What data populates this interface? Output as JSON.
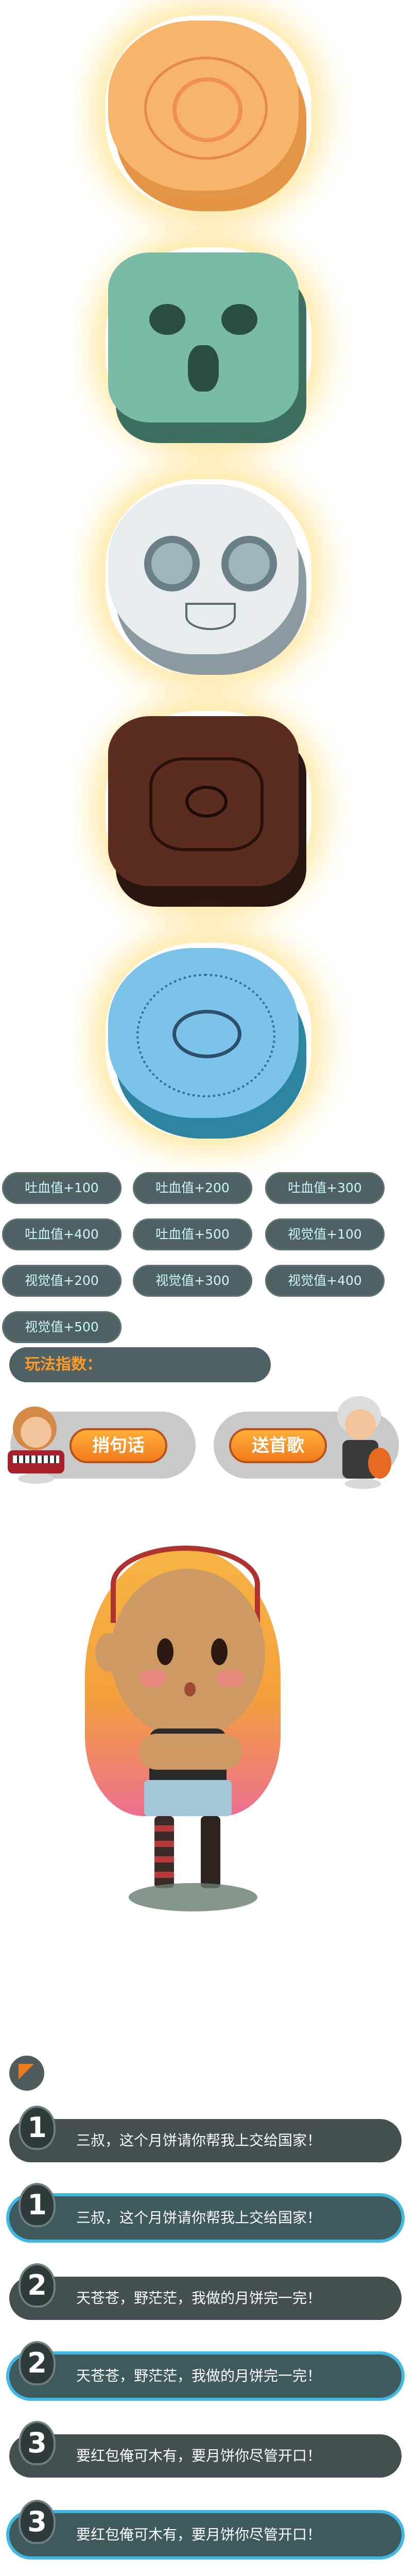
{
  "stats": [
    {
      "label": "吐血值+100"
    },
    {
      "label": "吐血值+200"
    },
    {
      "label": "吐血值+300"
    },
    {
      "label": "吐血值+400"
    },
    {
      "label": "吐血值+500"
    },
    {
      "label": "视觉值+100"
    },
    {
      "label": "视觉值+200"
    },
    {
      "label": "视觉值+300"
    },
    {
      "label": "视觉值+400"
    },
    {
      "label": "视觉值+500"
    }
  ],
  "strategy": {
    "label": "玩法指数："
  },
  "actions": {
    "left_label": "捎句话",
    "right_label": "送首歌"
  },
  "lines": [
    {
      "num": "1",
      "text": "三叔，这个月饼请你帮我上交给国家！"
    },
    {
      "num": "1",
      "text": "三叔，这个月饼请你帮我上交给国家！"
    },
    {
      "num": "2",
      "text": "天苍苍，野茫茫，我做的月饼完一完！"
    },
    {
      "num": "2",
      "text": "天苍苍，野茫茫，我做的月饼完一完！"
    },
    {
      "num": "3",
      "text": "要红包俺可木有，要月饼你尽管开口！"
    },
    {
      "num": "3",
      "text": "要红包俺可木有，要月饼你尽管开口！"
    }
  ],
  "colors": {
    "pill_bg": "#4f6163",
    "pill_text": "#cdf6ff",
    "accent_orange": "#f07b1c",
    "row_highlight": "#3fb9e4"
  },
  "icons": [
    "mooncake-orange",
    "mooncake-teal",
    "mooncake-silver",
    "mooncake-dark",
    "mooncake-blue",
    "pipa-girl-avatar",
    "guitar-boy-avatar",
    "section-marker-icon"
  ]
}
